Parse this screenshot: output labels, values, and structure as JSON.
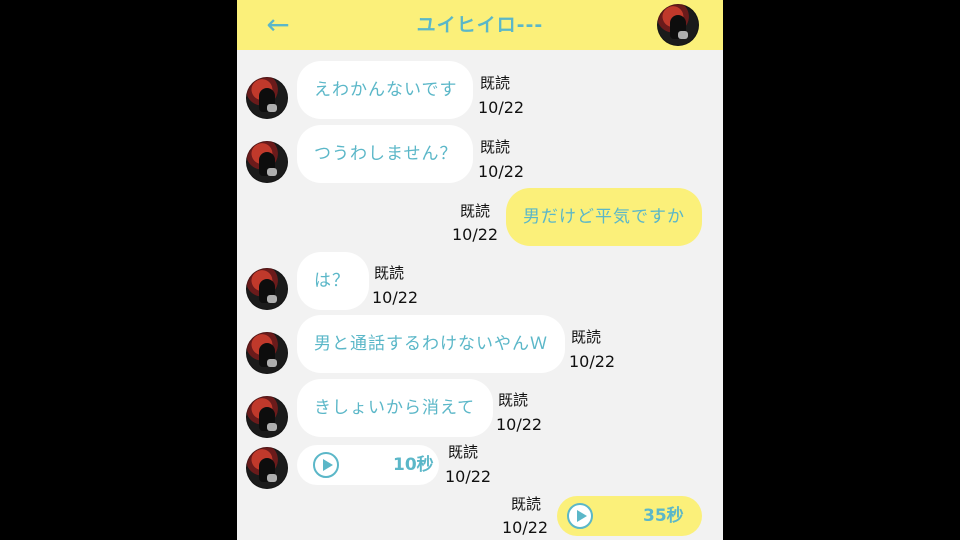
{
  "header": {
    "title": "ユイヒイロ---",
    "back_icon": "←"
  },
  "messages": [
    {
      "text": "えわかんないです",
      "read": "既読",
      "time": "10/22"
    },
    {
      "text": "つうわしません？",
      "read": "既読",
      "time": "10/22"
    },
    {
      "text": "男だけど平気ですか",
      "read": "既読",
      "time": "10/22"
    },
    {
      "text": "は？",
      "read": "既読",
      "time": "10/22"
    },
    {
      "text": "男と通話するわけないやんＷ",
      "read": "既読",
      "time": "10/22"
    },
    {
      "text": "きしょいから消えて",
      "read": "既読",
      "time": "10/22"
    },
    {
      "text": "10秒",
      "read": "既読",
      "time": "10/22"
    },
    {
      "text": "35秒",
      "read": "既読",
      "time": "10/22"
    }
  ]
}
